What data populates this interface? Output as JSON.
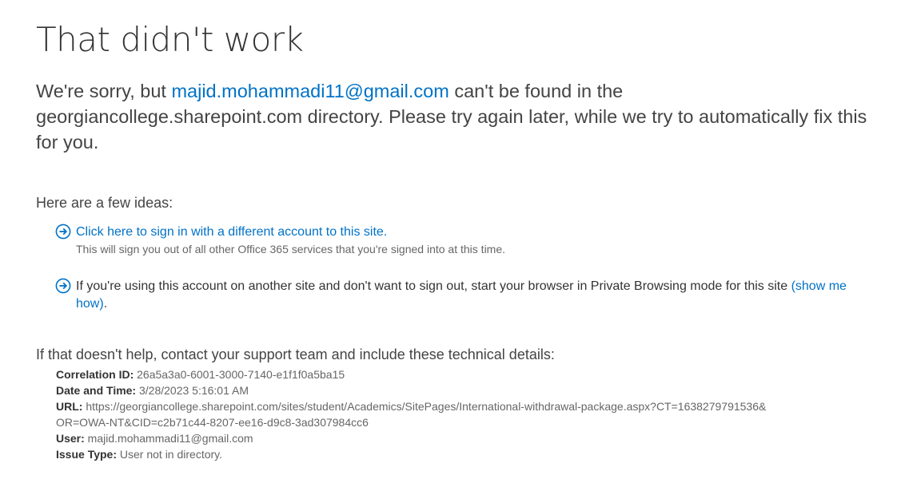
{
  "title": "That didn't work",
  "message": {
    "before": "We're sorry, but ",
    "email": "majid.mohammadi11@gmail.com",
    "after_line1": " can't be found in the",
    "line2": "georgiancollege.sharepoint.com directory. Please try again later, while we try to automatically fix this",
    "line3": "for you."
  },
  "ideas": {
    "heading": "Here are a few ideas:",
    "item1": {
      "icon": "arrow-circle-right-icon",
      "link": "Click here to sign in with a different account to this site.",
      "sub": "This will sign you out of all other Office 365 services that you're signed into at this time."
    },
    "item2": {
      "icon": "arrow-circle-right-icon",
      "text_line1": "If you're using this account on another site and don't want to sign out, start your browser in Private Browsing mode for this site ",
      "link_part1": "(show me",
      "link_part2": "how)",
      "text_end": "."
    }
  },
  "help": {
    "heading": "If that doesn't help, contact your support team and include these technical details:"
  },
  "details": {
    "correlation_label": "Correlation ID:",
    "correlation_value": " 26a5a3a0-6001-3000-7140-e1f1f0a5ba15",
    "datetime_label": "Date and Time:",
    "datetime_value": " 3/28/2023 5:16:01 AM",
    "url_label": "URL:",
    "url_value_line1": " https://georgiancollege.sharepoint.com/sites/student/Academics/SitePages/International-withdrawal-package.aspx?CT=1638279791536&",
    "url_value_line2": "OR=OWA-NT&CID=c2b71c44-8207-ee16-d9c8-3ad307984cc6",
    "user_label": "User:",
    "user_value": " majid.mohammadi11@gmail.com",
    "issue_label": "Issue Type:",
    "issue_value": " User not in directory."
  },
  "colors": {
    "link": "#0072c6",
    "text": "#444444"
  }
}
